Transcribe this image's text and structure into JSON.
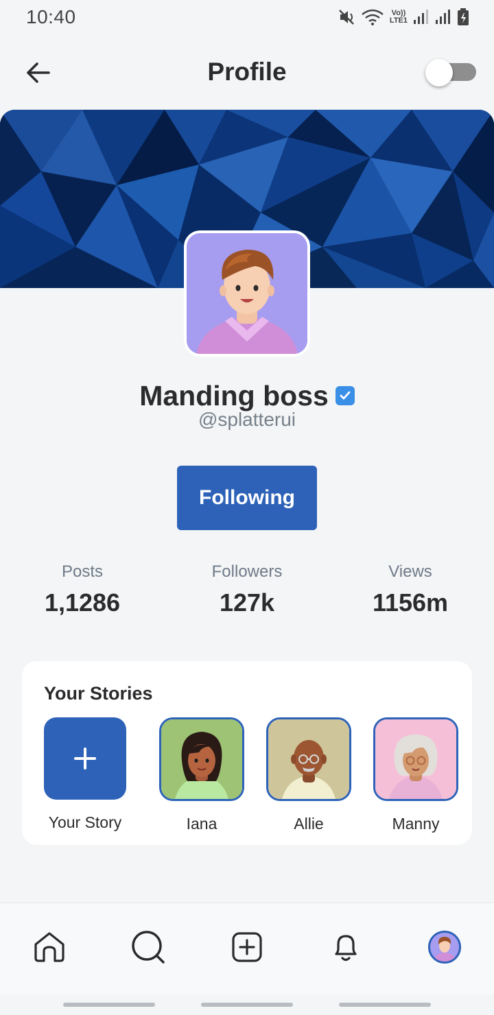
{
  "status_bar": {
    "time": "10:40",
    "network_label_top": "Vo))",
    "network_label_bottom": "LTE1",
    "icons": [
      "mute-icon",
      "wifi-icon",
      "signal-icon",
      "signal-icon",
      "battery-icon"
    ]
  },
  "header": {
    "title": "Profile",
    "back_icon": "arrow-left-icon",
    "theme_toggle_on": false
  },
  "profile": {
    "name": "Manding boss",
    "handle": "@splatterui",
    "verified": true,
    "follow_label": "Following"
  },
  "stats": [
    {
      "label": "Posts",
      "value": "1,1286"
    },
    {
      "label": "Followers",
      "value": "127k"
    },
    {
      "label": "Views",
      "value": "1156m"
    }
  ],
  "stories": {
    "title": "Your Stories",
    "items": [
      {
        "label": "Your Story",
        "icon": "plus-icon"
      },
      {
        "label": "Iana"
      },
      {
        "label": "Allie"
      },
      {
        "label": "Manny"
      }
    ]
  },
  "bottom_nav": {
    "items": [
      "home-icon",
      "search-icon",
      "add-post-icon",
      "bell-icon",
      "profile-avatar"
    ]
  },
  "colors": {
    "accent": "#2d62b8",
    "verified": "#3a8fe6",
    "background": "#f3f5f6"
  }
}
